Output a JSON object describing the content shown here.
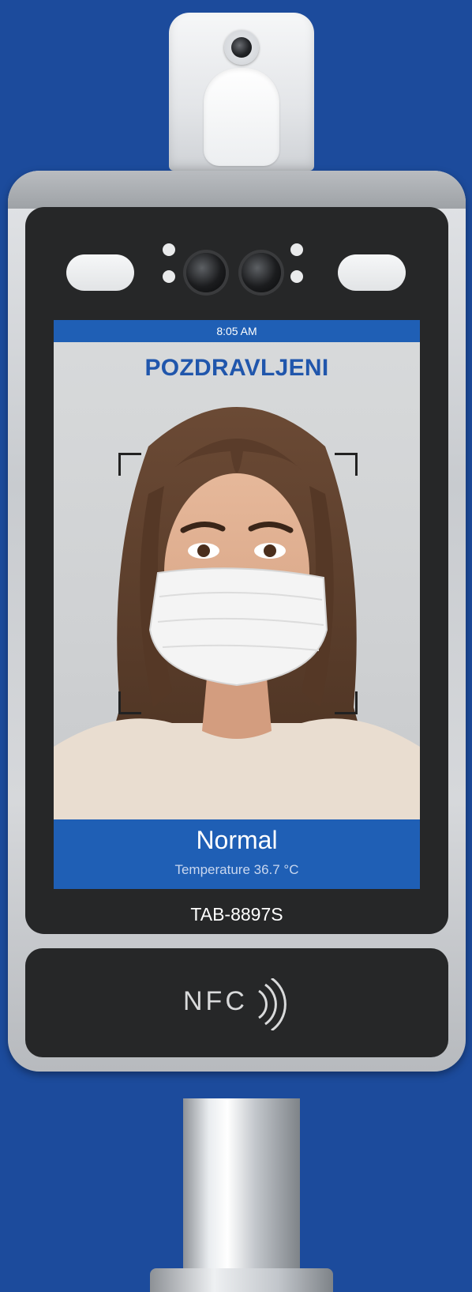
{
  "screen": {
    "time": "8:05 AM",
    "greeting": "POZDRAVLJENI",
    "status": "Normal",
    "temperature": "Temperature 36.7 °C"
  },
  "device": {
    "model": "TAB-8897S",
    "nfc": "NFC"
  },
  "colors": {
    "background": "#1c4b9c",
    "accent_blue": "#1f5fb5",
    "greeting_text": "#2056ac",
    "bezel": "#262728"
  },
  "icons": [
    "thermal-camera-icon",
    "face-camera-icon",
    "infrared-sensor-icon",
    "nfc-icon"
  ]
}
